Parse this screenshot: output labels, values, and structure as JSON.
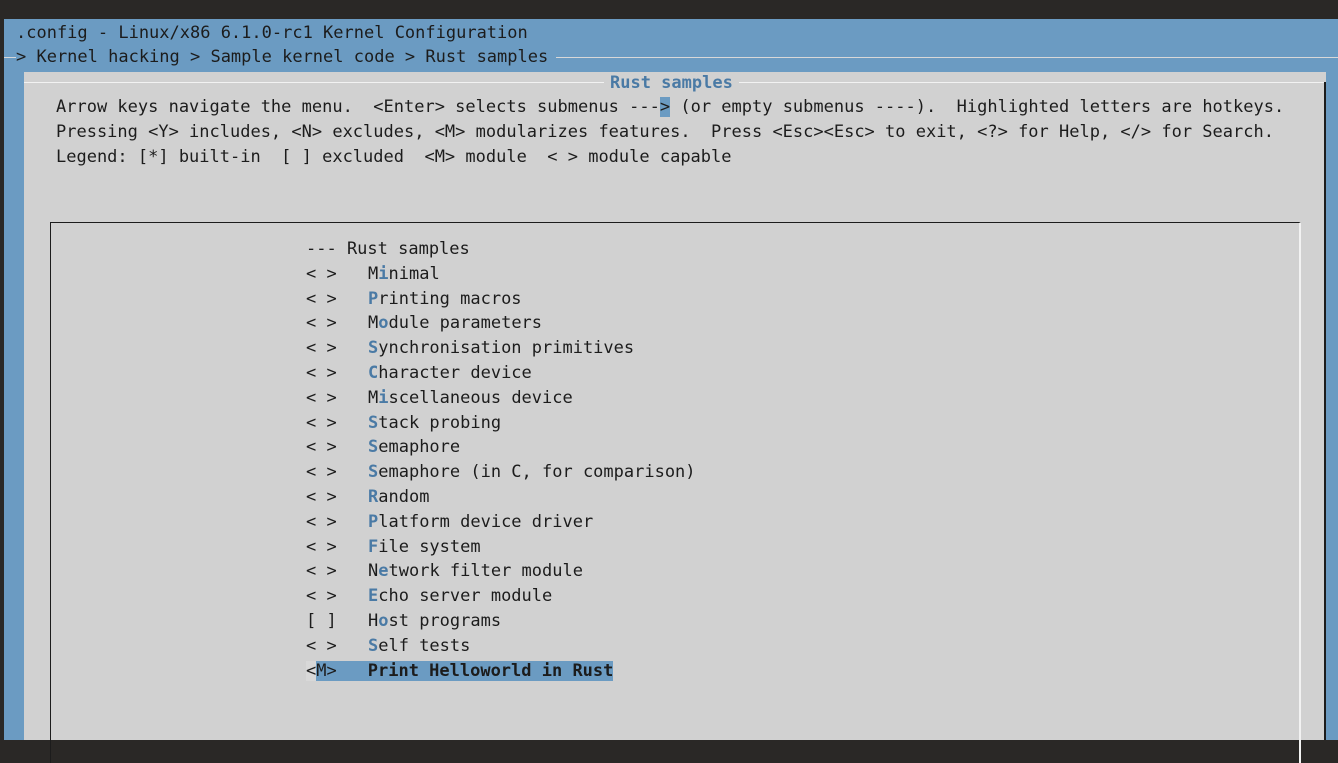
{
  "window": {
    "title": ".config - Linux/x86 6.1.0-rc1 Kernel Configuration",
    "breadcrumb": "> Kernel hacking > Sample kernel code > Rust samples"
  },
  "dialog": {
    "title": "Rust samples",
    "help": [
      [
        "Arrow keys navigate the menu.  <Enter> selects submenus ---",
        ">",
        " (or empty submenus ----).  Highlighted letters are hotkeys."
      ],
      "Pressing <Y> includes, <N> excludes, <M> modularizes features.  Press <Esc><Esc> to exit, <?> for Help, </> for Search.",
      "Legend: [*] built-in  [ ] excluded  <M> module  < > module capable"
    ]
  },
  "menu": {
    "header": "--- Rust samples",
    "items": [
      {
        "marker": "< >",
        "pre": "M",
        "hot": "i",
        "post": "nimal"
      },
      {
        "marker": "< >",
        "pre": "",
        "hot": "P",
        "post": "rinting macros"
      },
      {
        "marker": "< >",
        "pre": "M",
        "hot": "o",
        "post": "dule parameters"
      },
      {
        "marker": "< >",
        "pre": "",
        "hot": "S",
        "post": "ynchronisation primitives"
      },
      {
        "marker": "< >",
        "pre": "",
        "hot": "C",
        "post": "haracter device"
      },
      {
        "marker": "< >",
        "pre": "M",
        "hot": "i",
        "post": "scellaneous device"
      },
      {
        "marker": "< >",
        "pre": "",
        "hot": "S",
        "post": "tack probing"
      },
      {
        "marker": "< >",
        "pre": "",
        "hot": "S",
        "post": "emaphore"
      },
      {
        "marker": "< >",
        "pre": "",
        "hot": "S",
        "post": "emaphore (in C, for comparison)"
      },
      {
        "marker": "< >",
        "pre": "",
        "hot": "R",
        "post": "andom"
      },
      {
        "marker": "< >",
        "pre": "",
        "hot": "P",
        "post": "latform device driver"
      },
      {
        "marker": "< >",
        "pre": "",
        "hot": "F",
        "post": "ile system"
      },
      {
        "marker": "< >",
        "pre": "N",
        "hot": "e",
        "post": "twork filter module"
      },
      {
        "marker": "< >",
        "pre": "",
        "hot": "E",
        "post": "cho server module"
      },
      {
        "marker": "[ ]",
        "pre": "H",
        "hot": "o",
        "post": "st programs"
      },
      {
        "marker": "< >",
        "pre": "",
        "hot": "S",
        "post": "elf tests"
      }
    ],
    "selected": {
      "marker_open": "<",
      "marker_value": "M",
      "marker_close": ">",
      "label": "Print Helloworld in Rust"
    }
  },
  "colors": {
    "blue": "#6b9bc2",
    "panel": "#d1d1d1",
    "hotkey": "#4a7aa5"
  }
}
